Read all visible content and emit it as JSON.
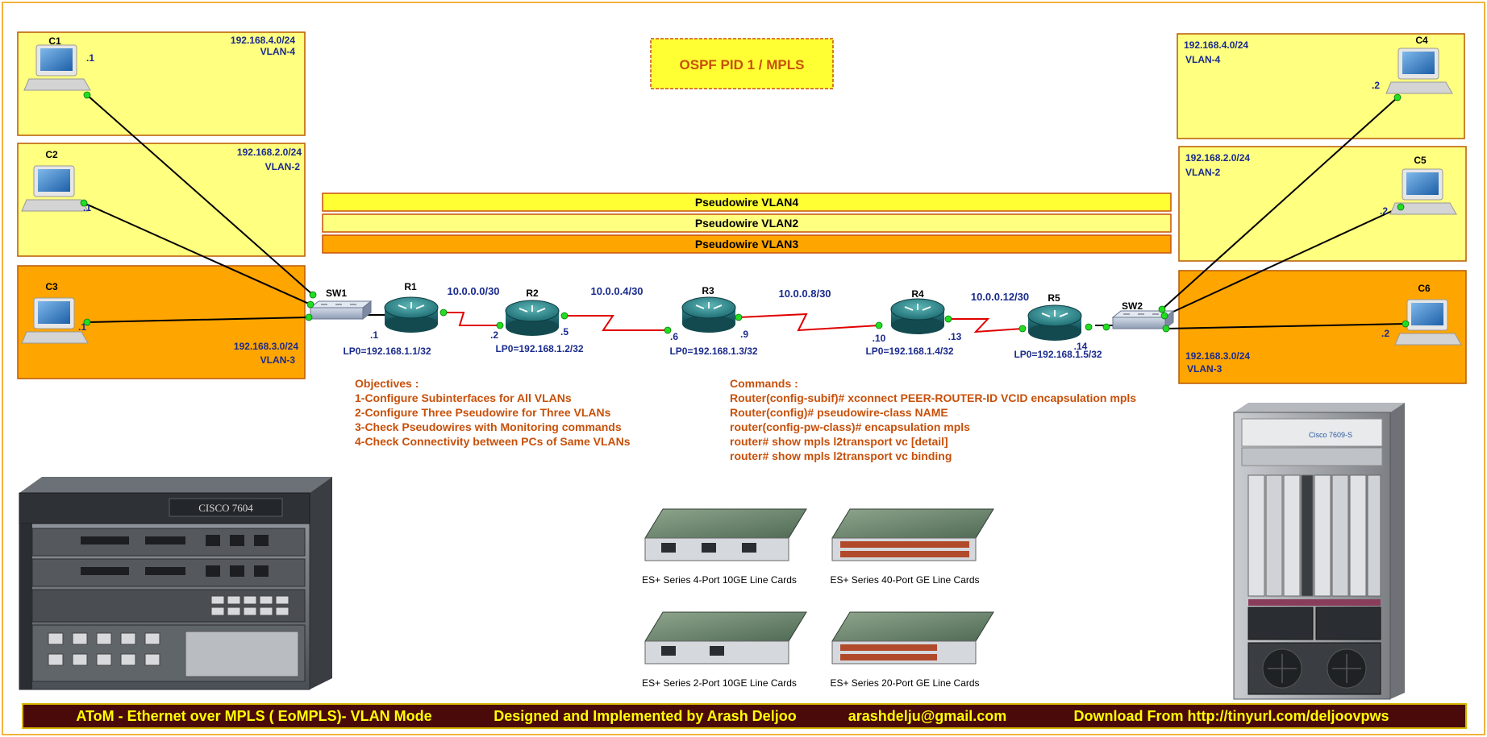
{
  "colors": {
    "frame": "#f2b33d",
    "zone_yellow": "#ffff80",
    "zone_orange": "#ffa500",
    "zone_border": "#b85a00",
    "ospf_fill": "#ffff33",
    "ospf_text": "#c8500a",
    "label_blue": "#1a2b8c",
    "objective_text": "#c8500a",
    "link_red": "#e00000",
    "port_green": "#22dd22",
    "footer_bg": "#4a0a0a",
    "footer_text": "#ffff00"
  },
  "ospf_label": "OSPF PID 1 / MPLS",
  "pseudowires": {
    "vlan4": "Pseudowire VLAN4",
    "vlan2": "Pseudowire VLAN2",
    "vlan3": "Pseudowire VLAN3"
  },
  "zones": {
    "left_vlan4": {
      "subnet": "192.168.4.0/24",
      "vlan": "VLAN-4"
    },
    "left_vlan2": {
      "subnet": "192.168.2.0/24",
      "vlan": "VLAN-2"
    },
    "left_vlan3": {
      "subnet": "192.168.3.0/24",
      "vlan": "VLAN-3"
    },
    "right_vlan4": {
      "subnet": "192.168.4.0/24",
      "vlan": "VLAN-4"
    },
    "right_vlan2": {
      "subnet": "192.168.2.0/24",
      "vlan": "VLAN-2"
    },
    "right_vlan3": {
      "subnet": "192.168.3.0/24",
      "vlan": "VLAN-3"
    }
  },
  "hosts": {
    "c1": {
      "name": "C1",
      "ip": ".1"
    },
    "c2": {
      "name": "C2",
      "ip": ".1"
    },
    "c3": {
      "name": "C3",
      "ip": ".1"
    },
    "c4": {
      "name": "C4",
      "ip": ".2"
    },
    "c5": {
      "name": "C5",
      "ip": ".2"
    },
    "c6": {
      "name": "C6",
      "ip": ".2"
    }
  },
  "switches": {
    "sw1": "SW1",
    "sw2": "SW2"
  },
  "routers": {
    "r1": {
      "name": "R1",
      "loopback": "LP0=192.168.1.1/32"
    },
    "r2": {
      "name": "R2",
      "loopback": "LP0=192.168.1.2/32"
    },
    "r3": {
      "name": "R3",
      "loopback": "LP0=192.168.1.3/32"
    },
    "r4": {
      "name": "R4",
      "loopback": "LP0=192.168.1.4/32"
    },
    "r5": {
      "name": "R5",
      "loopback": "LP0=192.168.1.5/32"
    }
  },
  "links": {
    "r1_r2": {
      "subnet": "10.0.0.0/30",
      "a": ".1",
      "b": ".2"
    },
    "r2_r3": {
      "subnet": "10.0.0.4/30",
      "a": ".5",
      "b": ".6"
    },
    "r3_r4": {
      "subnet": "10.0.0.8/30",
      "a": ".9",
      "b": ".10"
    },
    "r4_r5": {
      "subnet": "10.0.0.12/30",
      "a": ".13",
      "b": ".14"
    }
  },
  "objectives": {
    "title": "Objectives :",
    "items": [
      "1-Configure Subinterfaces for All VLANs",
      "2-Configure Three Pseudowire for Three VLANs",
      "3-Check Pseudowires with Monitoring commands",
      "4-Check Connectivity between PCs of Same VLANs"
    ]
  },
  "commands": {
    "title": "Commands :",
    "items": [
      "Router(config-subif)# xconnect PEER-ROUTER-ID VCID encapsulation mpls",
      "Router(config)# pseudowire-class NAME",
      "router(config-pw-class)# encapsulation mpls",
      "router# show mpls l2transport vc [detail]",
      "router# show mpls l2transport vc binding"
    ]
  },
  "chassis_left": {
    "brand": "CISCO 7604"
  },
  "chassis_right": {
    "brand": "Cisco 7609-S"
  },
  "line_cards": [
    "ES+ Series 4-Port 10GE Line Cards",
    "ES+ Series 40-Port GE Line Cards",
    "ES+ Series 2-Port 10GE Line Cards",
    "ES+ Series 20-Port GE Line Cards"
  ],
  "footer": {
    "title": "AToM - Ethernet over MPLS ( EoMPLS)- VLAN Mode",
    "designer": "Designed and Implemented by Arash Deljoo",
    "email": "arashdelju@gmail.com",
    "download": "Download From http://tinyurl.com/deljoovpws"
  }
}
